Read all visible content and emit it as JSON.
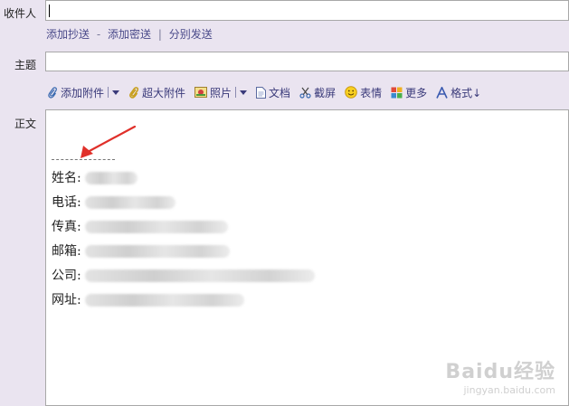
{
  "recipient": {
    "label": "收件人",
    "value": ""
  },
  "cc_links": {
    "cc": "添加抄送",
    "dash": "-",
    "bcc": "添加密送",
    "bar": "|",
    "separate": "分别发送"
  },
  "subject": {
    "label": "主题",
    "value": ""
  },
  "toolbar": {
    "attach": "添加附件",
    "big_attach": "超大附件",
    "photo": "照片",
    "doc": "文档",
    "screenshot": "截屏",
    "emoji": "表情",
    "more": "更多",
    "format": "格式↓"
  },
  "body": {
    "label": "正文",
    "signature": [
      {
        "key": "姓名:"
      },
      {
        "key": "电话:"
      },
      {
        "key": "传真:"
      },
      {
        "key": "邮箱:"
      },
      {
        "key": "公司:"
      },
      {
        "key": "网址:"
      }
    ]
  },
  "watermark": {
    "brand": "Baidu经验",
    "url": "jingyan.baidu.com"
  },
  "colors": {
    "panel_bg": "#eae4f0",
    "arrow_red": "#e0302a",
    "link_color": "#4a4a8a"
  }
}
